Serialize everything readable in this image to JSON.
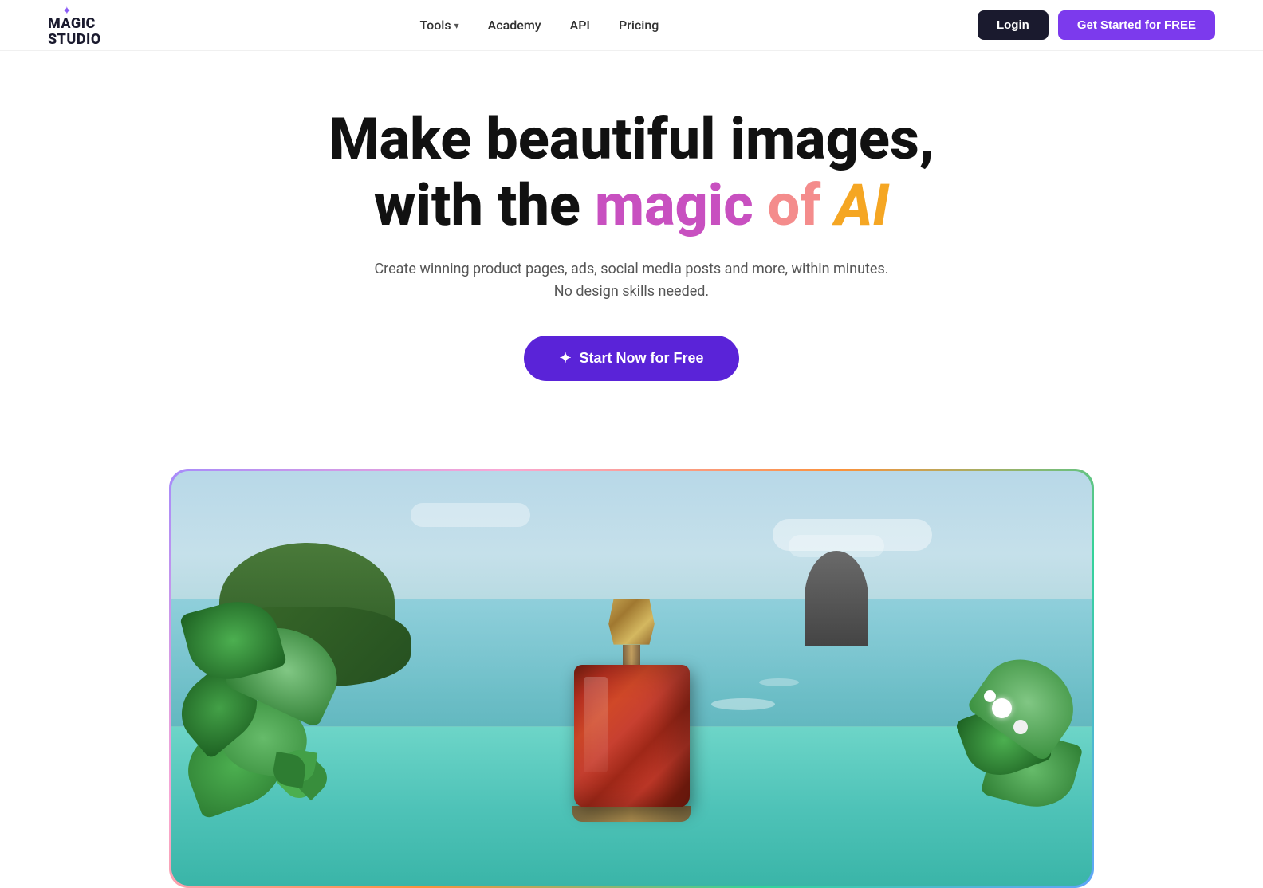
{
  "navbar": {
    "logo": {
      "line1": "MAGIC",
      "line2": "STUDIO"
    },
    "nav_links": [
      {
        "label": "Tools",
        "has_dropdown": true
      },
      {
        "label": "Academy",
        "has_dropdown": false
      },
      {
        "label": "API",
        "has_dropdown": false
      },
      {
        "label": "Pricing",
        "has_dropdown": false
      }
    ],
    "login_label": "Login",
    "get_started_label": "Get Started for FREE"
  },
  "hero": {
    "title_line1": "Make beautiful images,",
    "title_line2_prefix": "with the ",
    "title_magic": "magic",
    "title_of": "of",
    "title_ai": "AI",
    "subtitle_line1": "Create winning product pages, ads, social media posts and more, within minutes.",
    "subtitle_line2": "No design skills needed.",
    "cta_label": "Start Now for Free"
  },
  "showcase": {
    "alt": "AI-generated product photo of perfume bottle in scenic coastal setting"
  }
}
